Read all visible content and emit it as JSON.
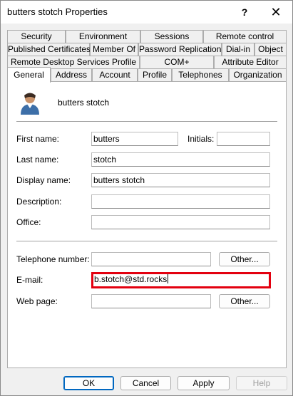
{
  "window": {
    "title": "butters stotch Properties"
  },
  "titlebar": {
    "help_glyph": "?",
    "close_glyph": "✕"
  },
  "tabs": {
    "row1": [
      "Security",
      "Environment",
      "Sessions",
      "Remote control"
    ],
    "row2": [
      "Published Certificates",
      "Member Of",
      "Password Replication",
      "Dial-in",
      "Object"
    ],
    "row3": [
      "Remote Desktop Services Profile",
      "COM+",
      "Attribute Editor"
    ],
    "row4": [
      "General",
      "Address",
      "Account",
      "Profile",
      "Telephones",
      "Organization"
    ],
    "active": "General"
  },
  "general": {
    "display_name_header": "butters stotch",
    "first_name_label": "First name:",
    "first_name": "butters",
    "initials_label": "Initials:",
    "initials": "",
    "last_name_label": "Last name:",
    "last_name": "stotch",
    "display_name_label": "Display name:",
    "display_name": "butters stotch",
    "description_label": "Description:",
    "description": "",
    "office_label": "Office:",
    "office": "",
    "telephone_label": "Telephone number:",
    "telephone": "",
    "email_label": "E-mail:",
    "email": "b.stotch@std.rocks",
    "webpage_label": "Web page:",
    "webpage": "",
    "other_label": "Other..."
  },
  "buttons": {
    "ok": "OK",
    "cancel": "Cancel",
    "apply": "Apply",
    "help": "Help"
  },
  "colors": {
    "highlight": "#e3000f",
    "default_button_border": "#0067c0"
  },
  "icons": {
    "avatar": "user-avatar-icon",
    "help": "question-icon",
    "close": "close-icon"
  }
}
